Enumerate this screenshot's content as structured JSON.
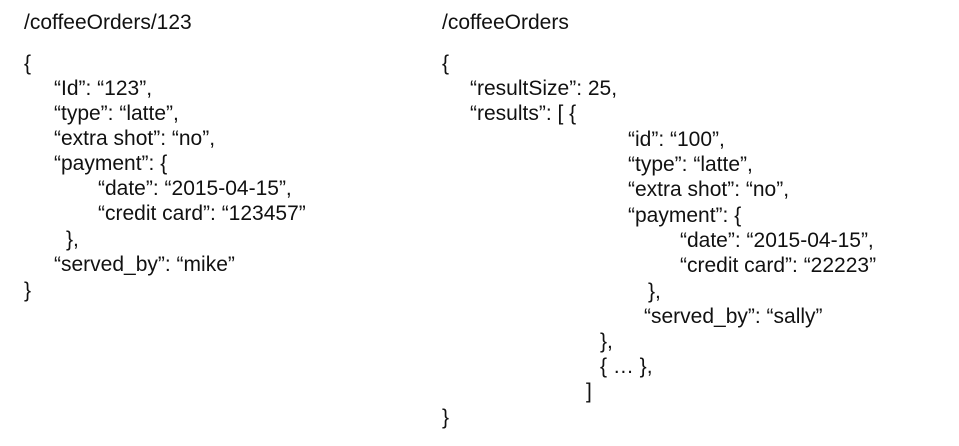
{
  "left": {
    "title": "/coffeeOrders/123",
    "lines": [
      "{",
      "“Id”: “123”,",
      "“type”: “latte”,",
      "“extra shot”: “no”,",
      "“payment”: {",
      "“date”: “2015-04-15”,",
      "“credit card”: “123457”",
      "},",
      "“served_by”: “mike”",
      "}"
    ]
  },
  "right": {
    "title": "/coffeeOrders",
    "lines": [
      "{",
      "“resultSize”: 25,",
      "“results”: [ {",
      "“id”: “100”,",
      "“type”: “latte”,",
      "“extra shot”: “no”,",
      "“payment”: {",
      "“date”: “2015-04-15”,",
      "“credit card”: “22223”",
      "},",
      "“served_by”: “sally”",
      "},",
      "{ … },",
      "]",
      "}"
    ]
  }
}
